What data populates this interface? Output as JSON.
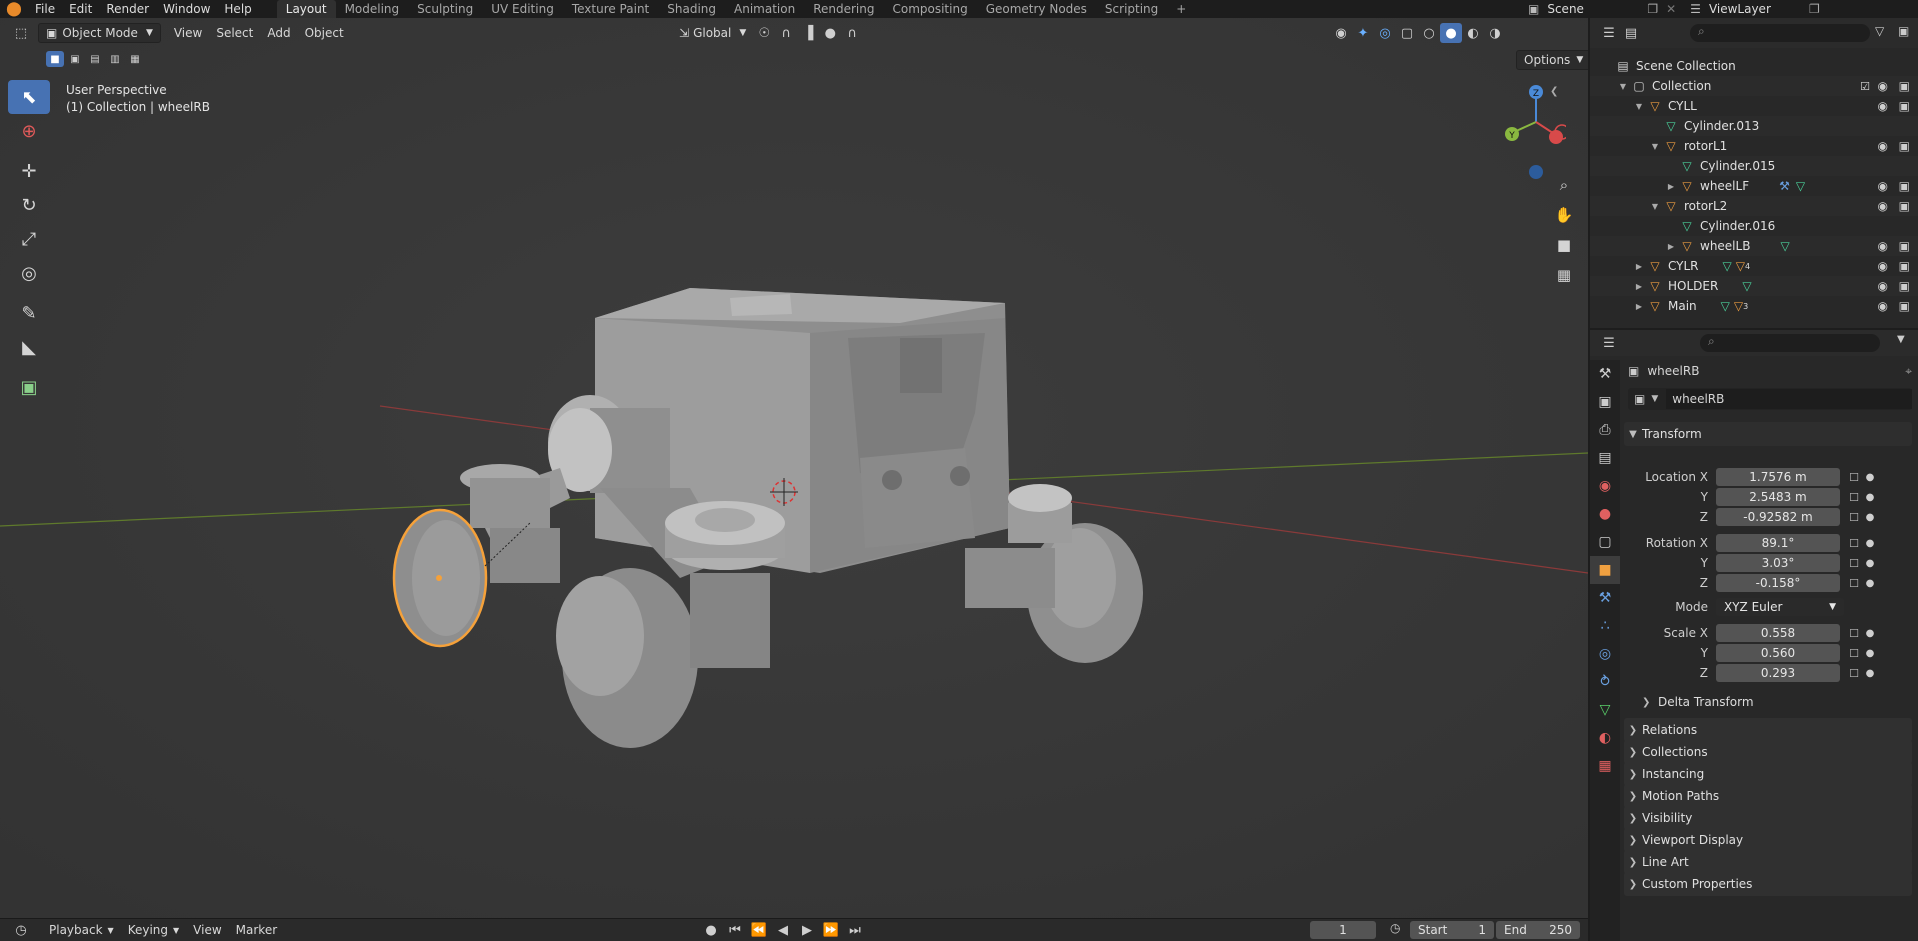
{
  "topbar": {
    "menus": [
      "File",
      "Edit",
      "Render",
      "Window",
      "Help"
    ],
    "workspaces": [
      "Layout",
      "Modeling",
      "Sculpting",
      "UV Editing",
      "Texture Paint",
      "Shading",
      "Animation",
      "Rendering",
      "Compositing",
      "Geometry Nodes",
      "Scripting"
    ],
    "active_workspace": "Layout",
    "add_tab": "+",
    "scene": "Scene",
    "view_layer": "ViewLayer"
  },
  "viewport": {
    "mode": "Object Mode",
    "menus": [
      "View",
      "Select",
      "Add",
      "Object"
    ],
    "transform_orientation": "Global",
    "options": "Options",
    "info_line1": "User Perspective",
    "info_line2": "(1) Collection | wheelRB",
    "gizmo": {
      "z": "Z",
      "y": "Y"
    }
  },
  "timeline": {
    "menus": [
      "Playback",
      "Keying",
      "View",
      "Marker"
    ],
    "current_frame": "1",
    "start_label": "Start",
    "start": "1",
    "end_label": "End",
    "end": "250"
  },
  "outliner": {
    "search_placeholder": "",
    "rows": [
      {
        "label": "Scene Collection",
        "indent": 0,
        "icon": "scene-collection-icon"
      },
      {
        "label": "Collection",
        "indent": 1,
        "icon": "collection-icon"
      },
      {
        "label": "CYLL",
        "indent": 2,
        "icon": "object-icon"
      },
      {
        "label": "Cylinder.013",
        "indent": 3,
        "icon": "mesh-icon"
      },
      {
        "label": "rotorL1",
        "indent": 3,
        "icon": "object-icon"
      },
      {
        "label": "Cylinder.015",
        "indent": 4,
        "icon": "mesh-icon"
      },
      {
        "label": "wheelLF",
        "indent": 4,
        "icon": "object-icon"
      },
      {
        "label": "rotorL2",
        "indent": 3,
        "icon": "object-icon"
      },
      {
        "label": "Cylinder.016",
        "indent": 4,
        "icon": "mesh-icon"
      },
      {
        "label": "wheelLB",
        "indent": 4,
        "icon": "object-icon"
      },
      {
        "label": "CYLR",
        "indent": 2,
        "icon": "object-icon"
      },
      {
        "label": "HOLDER",
        "indent": 2,
        "icon": "object-icon"
      },
      {
        "label": "Main",
        "indent": 2,
        "icon": "object-icon"
      }
    ],
    "badges": {
      "cylr": "4",
      "main": "3"
    }
  },
  "properties": {
    "object_name": "wheelRB",
    "data_name": "wheelRB",
    "transform_label": "Transform",
    "location": {
      "label": "Location X",
      "x": "1.7576 m",
      "y_label": "Y",
      "y": "2.5483 m",
      "z_label": "Z",
      "z": "-0.92582 m"
    },
    "rotation": {
      "label": "Rotation X",
      "x": "89.1°",
      "y_label": "Y",
      "y": "3.03°",
      "z_label": "Z",
      "z": "-0.158°"
    },
    "mode": {
      "label": "Mode",
      "value": "XYZ Euler"
    },
    "scale": {
      "label": "Scale X",
      "x": "0.558",
      "y_label": "Y",
      "y": "0.560",
      "z_label": "Z",
      "z": "0.293"
    },
    "delta_transform": "Delta Transform",
    "sections": [
      "Relations",
      "Collections",
      "Instancing",
      "Motion Paths",
      "Visibility",
      "Viewport Display",
      "Line Art",
      "Custom Properties"
    ]
  },
  "colors": {
    "accent": "#4772b3",
    "selection": "#f5a13a",
    "background": "#3a3a3a"
  }
}
